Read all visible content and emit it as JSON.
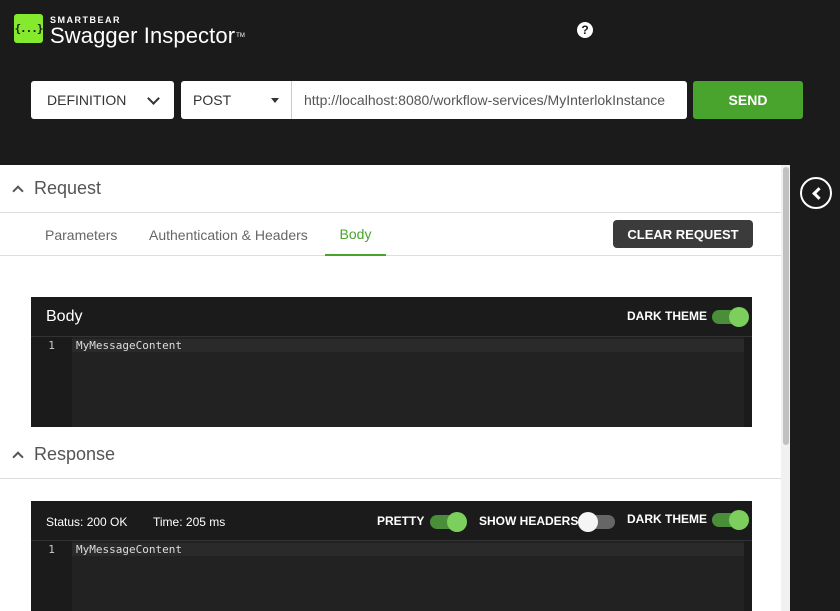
{
  "header": {
    "brand_small": "SMARTBEAR",
    "brand_big": "Swagger Inspector",
    "brand_tm": "TM",
    "logo_glyph": "{...}",
    "help_glyph": "?"
  },
  "toolbar": {
    "definition_label": "DEFINITION",
    "method_value": "POST",
    "url_value": "http://localhost:8080/workflow-services/MyInterlokInstance",
    "send_label": "SEND"
  },
  "request": {
    "section_title": "Request",
    "tabs": [
      {
        "label": "Parameters",
        "active": false
      },
      {
        "label": "Authentication & Headers",
        "active": false
      },
      {
        "label": "Body",
        "active": true
      }
    ],
    "clear_label": "CLEAR REQUEST",
    "body_panel": {
      "title": "Body",
      "dark_theme_label": "DARK THEME",
      "dark_theme_on": true,
      "line_number": "1",
      "content": "MyMessageContent"
    }
  },
  "response": {
    "section_title": "Response",
    "status": "Status: 200 OK",
    "time": "Time: 205 ms",
    "pretty_label": "PRETTY",
    "pretty_on": true,
    "show_headers_label": "SHOW HEADERS",
    "show_headers_on": false,
    "dark_theme_label": "DARK THEME",
    "dark_theme_on": true,
    "line_number": "1",
    "content": "MyMessageContent"
  },
  "colors": {
    "header_bg": "#1b1b1b",
    "accent_green": "#49a42d",
    "logo_green": "#85ea2d"
  }
}
